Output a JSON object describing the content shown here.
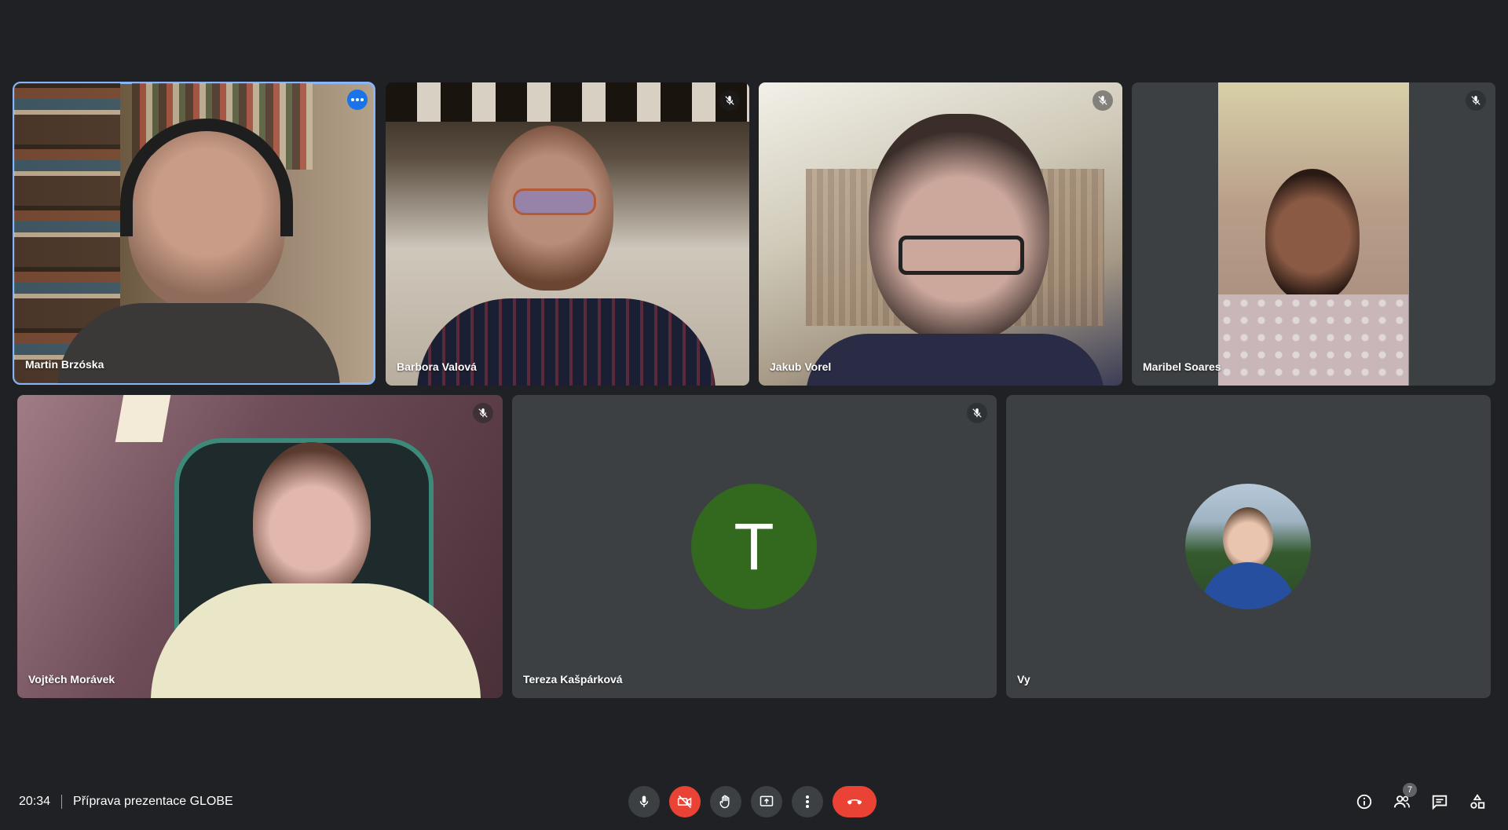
{
  "participants": [
    {
      "name": "Martin Brzóska",
      "muted": false,
      "active": true,
      "type": "video"
    },
    {
      "name": "Barbora Valová",
      "muted": true,
      "active": false,
      "type": "video"
    },
    {
      "name": "Jakub Vorel",
      "muted": true,
      "active": false,
      "type": "video"
    },
    {
      "name": "Maribel Soares",
      "muted": true,
      "active": false,
      "type": "video"
    },
    {
      "name": "Vojtěch Morávek",
      "muted": true,
      "active": false,
      "type": "video"
    },
    {
      "name": "Tereza Kašpárková",
      "muted": true,
      "active": false,
      "type": "initial",
      "initial": "T",
      "avatar_color": "#33691e"
    },
    {
      "name": "Vy",
      "muted": false,
      "active": false,
      "type": "photo"
    }
  ],
  "meeting": {
    "time": "20:34",
    "title": "Příprava prezentace GLOBE"
  },
  "controls": {
    "mic_icon": "microphone-icon",
    "camera_icon": "camera-off-icon",
    "hand_icon": "raise-hand-icon",
    "present_icon": "present-screen-icon",
    "more_icon": "more-options-icon",
    "hangup_icon": "hang-up-icon"
  },
  "right_panel": {
    "people_count": "7",
    "icons": [
      "info-icon",
      "people-icon",
      "chat-icon",
      "activities-icon"
    ]
  },
  "colors": {
    "background": "#202124",
    "tile": "#3c4043",
    "accent": "#8ab4f8",
    "danger": "#ea4335"
  }
}
